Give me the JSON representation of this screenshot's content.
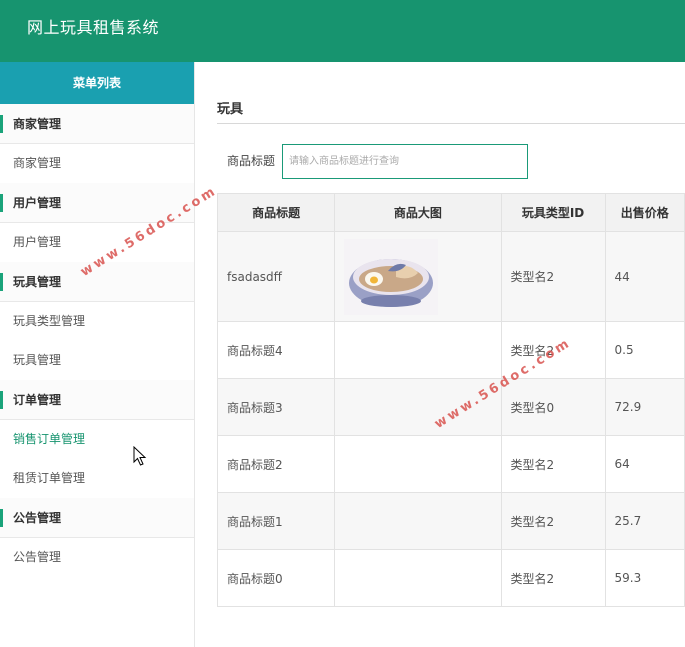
{
  "header": {
    "title": "网上玩具租售系统"
  },
  "sidebar": {
    "menu_title": "菜单列表",
    "groups": [
      {
        "label": "商家管理",
        "items": [
          "商家管理"
        ]
      },
      {
        "label": "用户管理",
        "items": [
          "用户管理"
        ]
      },
      {
        "label": "玩具管理",
        "items": [
          "玩具类型管理",
          "玩具管理"
        ]
      },
      {
        "label": "订单管理",
        "items": [
          "销售订单管理",
          "租赁订单管理"
        ]
      },
      {
        "label": "公告管理",
        "items": [
          "公告管理"
        ]
      }
    ],
    "active_item": "销售订单管理"
  },
  "main": {
    "section_title": "玩具",
    "search": {
      "label": "商品标题",
      "placeholder": "请输入商品标题进行查询",
      "value": ""
    },
    "table": {
      "headers": [
        "商品标题",
        "商品大图",
        "玩具类型ID",
        "出售价格"
      ],
      "rows": [
        {
          "title": "fsadasdff",
          "has_image": true,
          "type_id": "类型名2",
          "price": "44"
        },
        {
          "title": "商品标题4",
          "has_image": false,
          "type_id": "类型名2",
          "price": "0.5"
        },
        {
          "title": "商品标题3",
          "has_image": false,
          "type_id": "类型名0",
          "price": "72.9"
        },
        {
          "title": "商品标题2",
          "has_image": false,
          "type_id": "类型名2",
          "price": "64"
        },
        {
          "title": "商品标题1",
          "has_image": false,
          "type_id": "类型名2",
          "price": "25.7"
        },
        {
          "title": "商品标题0",
          "has_image": false,
          "type_id": "类型名2",
          "price": "59.3"
        }
      ]
    }
  },
  "watermark": "www.56doc.com",
  "colors": {
    "header_bg": "#17946f",
    "menu_head_bg": "#1aa0b0",
    "accent": "#1aa37a",
    "active_text": "#17946f",
    "watermark": "#d9534f"
  }
}
